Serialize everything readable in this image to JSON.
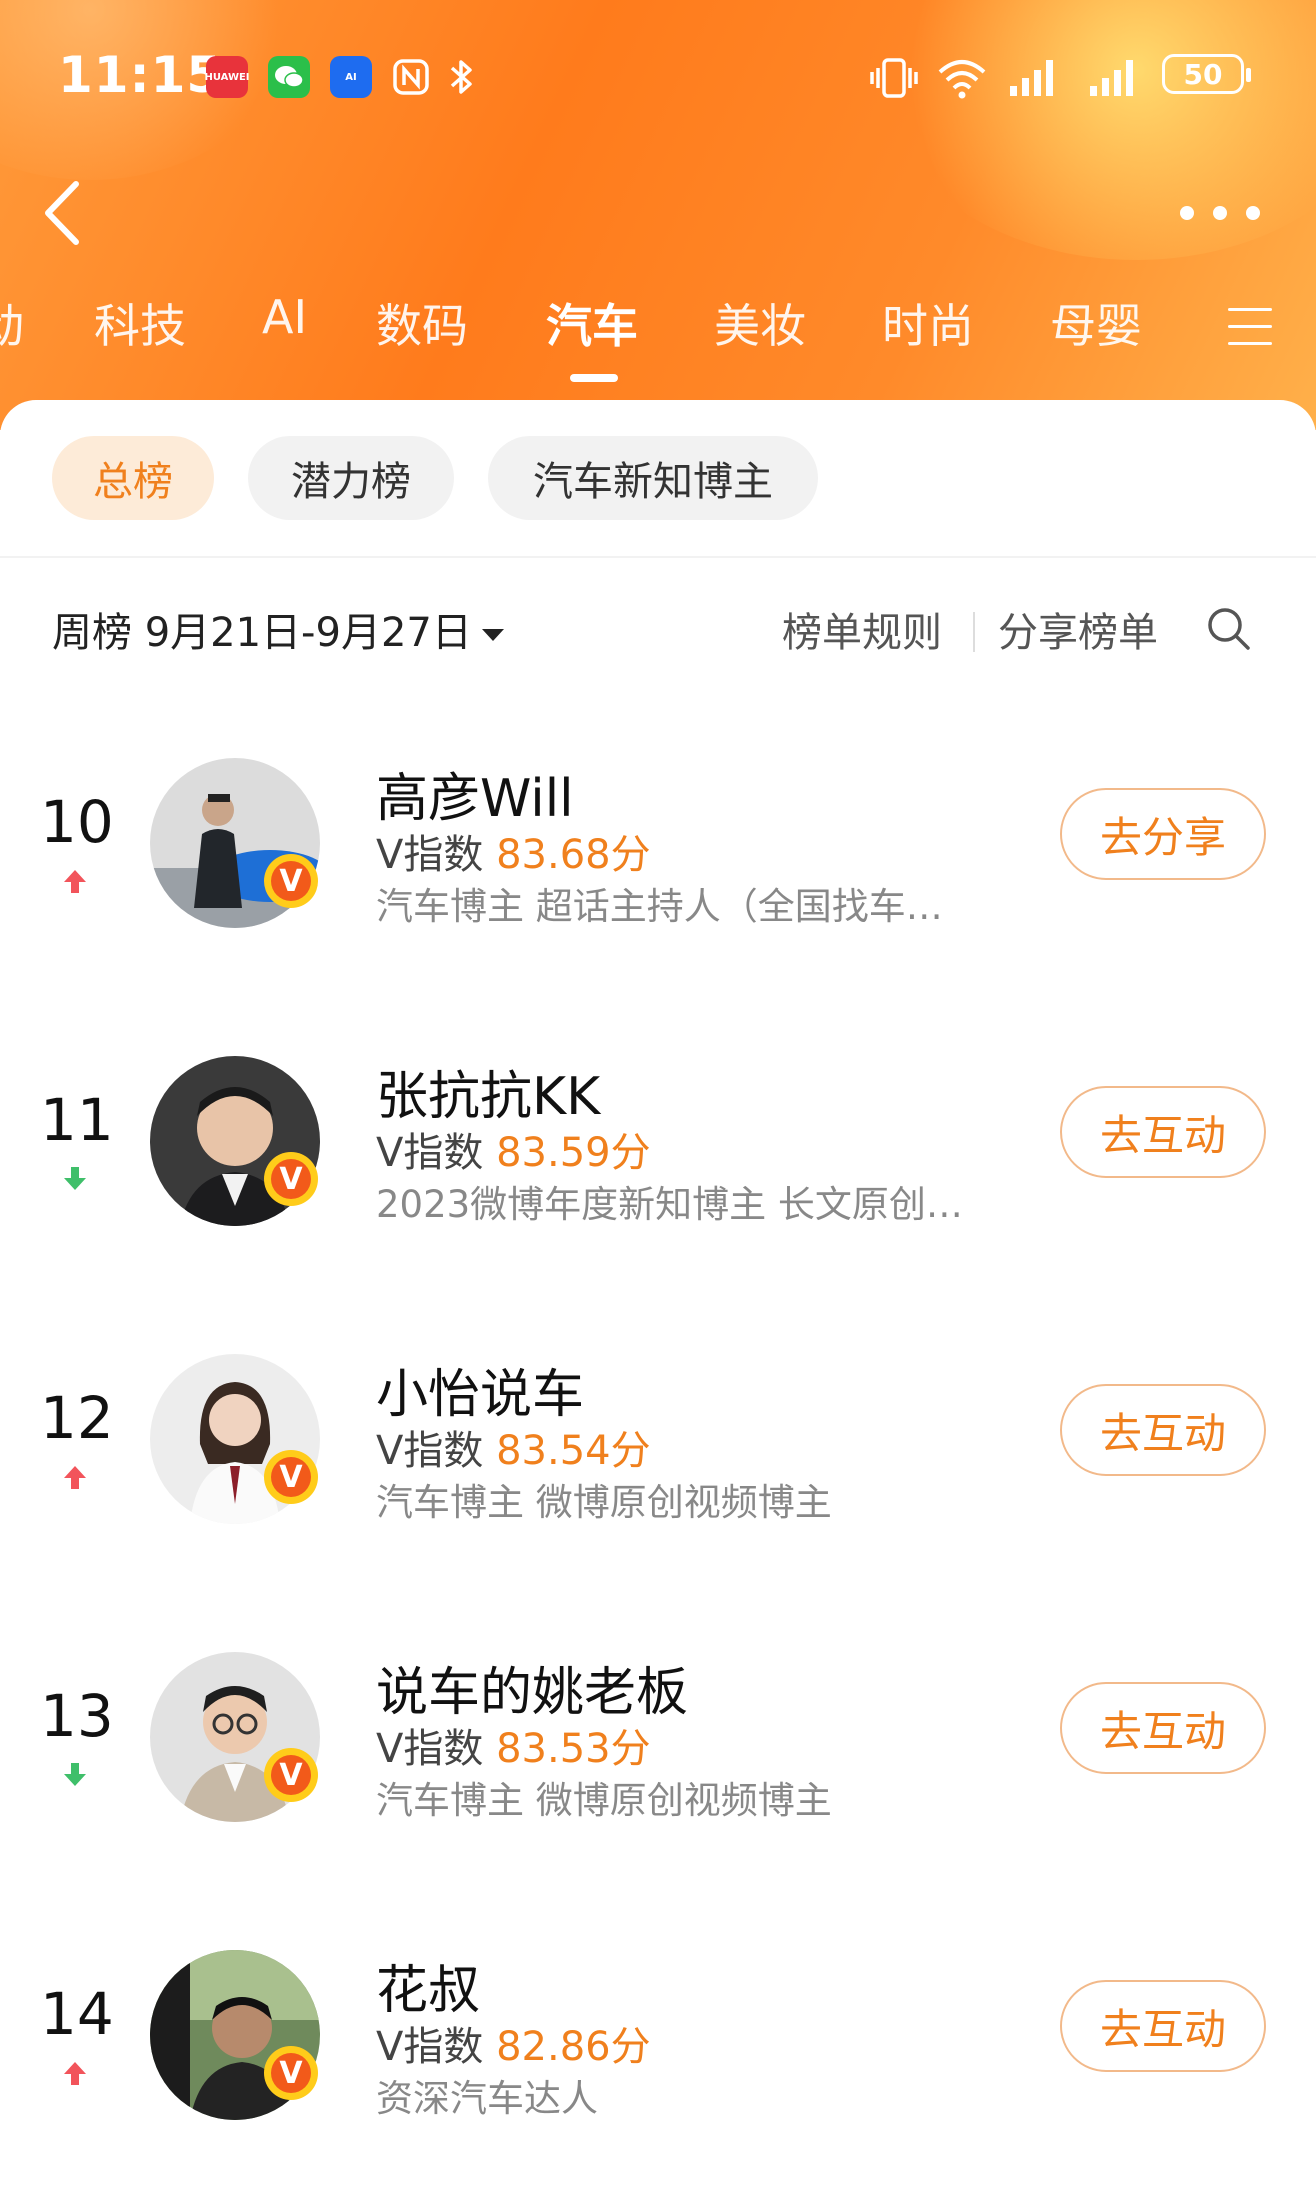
{
  "status_bar": {
    "time": "11:15",
    "app_icons": [
      "huawei-appgallery-icon",
      "wechat-icon",
      "ai-icon",
      "nfc-icon",
      "bluetooth-icon"
    ],
    "battery": "50"
  },
  "header": {
    "tabs": [
      {
        "label": "动"
      },
      {
        "label": "科技"
      },
      {
        "label": "AI"
      },
      {
        "label": "数码"
      },
      {
        "label": "汽车"
      },
      {
        "label": "美妆"
      },
      {
        "label": "时尚"
      },
      {
        "label": "母婴"
      }
    ],
    "active_tab": "汽车"
  },
  "filters": {
    "chips": [
      {
        "label": "总榜"
      },
      {
        "label": "潜力榜"
      },
      {
        "label": "汽车新知博主"
      }
    ],
    "active": "总榜"
  },
  "period": {
    "label": "周榜 9月21日-9月27日",
    "rules": "榜单规则",
    "share": "分享榜单"
  },
  "list": [
    {
      "rank": "10",
      "trend": "up",
      "name": "高彦Will",
      "vindex_label": "V指数",
      "score": "83.68分",
      "desc": "汽车博主 超话主持人（全国找车…",
      "action": "去分享"
    },
    {
      "rank": "11",
      "trend": "down",
      "name": "张抗抗KK",
      "vindex_label": "V指数",
      "score": "83.59分",
      "desc": "2023微博年度新知博主 长文原创…",
      "action": "去互动"
    },
    {
      "rank": "12",
      "trend": "up",
      "name": "小怡说车",
      "vindex_label": "V指数",
      "score": "83.54分",
      "desc": "汽车博主 微博原创视频博主",
      "action": "去互动"
    },
    {
      "rank": "13",
      "trend": "down",
      "name": "说车的姚老板",
      "vindex_label": "V指数",
      "score": "83.53分",
      "desc": "汽车博主 微博原创视频博主",
      "action": "去互动"
    },
    {
      "rank": "14",
      "trend": "up",
      "name": "花叔",
      "vindex_label": "V指数",
      "score": "82.86分",
      "desc": "资深汽车达人",
      "action": "去互动"
    }
  ],
  "colors": {
    "accent": "#f0801d",
    "trend_up": "#f2545b",
    "trend_down": "#3fbf6a",
    "header_orange": "#ff7b1c"
  }
}
